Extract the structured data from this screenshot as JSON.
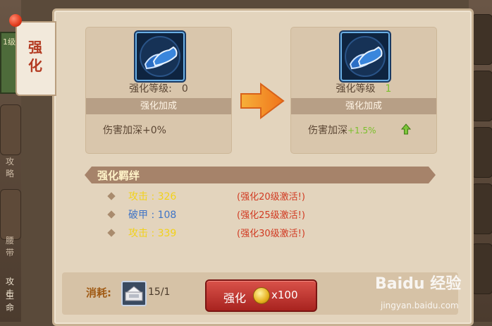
{
  "tab": {
    "label": "强化"
  },
  "left_side": {
    "level_badge": "1级",
    "slots": [
      "攻略",
      "腰带"
    ],
    "bottom_text": [
      "攻击",
      "生命"
    ]
  },
  "current": {
    "level_label": "强化等级:",
    "level_value": "0",
    "band_label": "强化加成",
    "bonus_text": "伤害加深+0%"
  },
  "next": {
    "level_label": "强化等级",
    "level_value": "1",
    "band_label": "强化加成",
    "bonus_label": "伤害加深",
    "bonus_value": "+1.5%"
  },
  "section": {
    "title": "强化羁绊"
  },
  "bonds": [
    {
      "stat": "攻击 : 326",
      "color": "#f2d21a",
      "condition": "(强化20级激活!)"
    },
    {
      "stat": "破甲 : 108",
      "color": "#3f74c6",
      "condition": "(强化25级激活!)"
    },
    {
      "stat": "攻击 : 339",
      "color": "#f2d21a",
      "condition": "(强化30级激活!)"
    }
  ],
  "cost": {
    "label": "消耗:",
    "count": "15/1"
  },
  "button": {
    "label": "强化",
    "amount": "x100"
  },
  "watermark": {
    "brand": "Baidu 经验",
    "url": "jingyan.baidu.com"
  }
}
